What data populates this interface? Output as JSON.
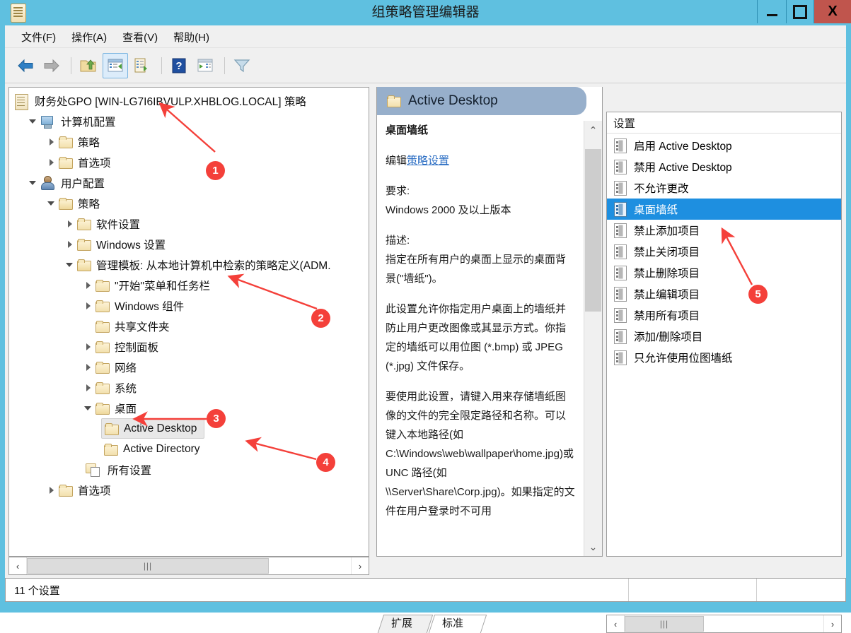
{
  "window": {
    "title": "组策略管理编辑器",
    "icon": "policy-scroll-icon",
    "controls": {
      "minimize": "–",
      "maximize": "□",
      "close": "X"
    },
    "titlebar_color": "#5FC0E0",
    "close_color": "#C0554D"
  },
  "menubar": {
    "items": [
      {
        "label": "文件(F)"
      },
      {
        "label": "操作(A)"
      },
      {
        "label": "查看(V)"
      },
      {
        "label": "帮助(H)"
      }
    ]
  },
  "toolbar": {
    "buttons": [
      {
        "name": "back-icon",
        "selected": false
      },
      {
        "name": "forward-icon",
        "selected": false
      },
      {
        "name": "up-folder-icon",
        "selected": false
      },
      {
        "name": "show-hide-tree-icon",
        "selected": true
      },
      {
        "name": "export-list-icon",
        "selected": false
      },
      {
        "name": "help-icon",
        "selected": false
      },
      {
        "name": "properties-icon",
        "selected": false
      },
      {
        "name": "filter-icon",
        "selected": false
      }
    ]
  },
  "tree": {
    "nodes": [
      {
        "label": "财务处GPO [WIN-LG7I6IBVULP.XHBLOG.LOCAL] 策略",
        "indent": 0,
        "icon": "policy-scroll-icon",
        "expander": "none",
        "selected": false
      },
      {
        "label": "计算机配置",
        "indent": 1,
        "icon": "computer-icon",
        "expander": "open",
        "selected": false
      },
      {
        "label": "策略",
        "indent": 2,
        "icon": "folder-icon",
        "expander": "closed",
        "selected": false
      },
      {
        "label": "首选项",
        "indent": 2,
        "icon": "folder-icon",
        "expander": "closed",
        "selected": false
      },
      {
        "label": "用户配置",
        "indent": 1,
        "icon": "user-icon",
        "expander": "open",
        "selected": false
      },
      {
        "label": "策略",
        "indent": 2,
        "icon": "folder-icon",
        "expander": "open",
        "selected": false
      },
      {
        "label": "软件设置",
        "indent": 3,
        "icon": "folder-icon",
        "expander": "closed",
        "selected": false
      },
      {
        "label": "Windows 设置",
        "indent": 3,
        "icon": "folder-icon",
        "expander": "closed",
        "selected": false
      },
      {
        "label": "管理模板: 从本地计算机中检索的策略定义(ADM.",
        "indent": 3,
        "icon": "folder-icon",
        "expander": "open",
        "selected": false
      },
      {
        "label": "\"开始\"菜单和任务栏",
        "indent": 4,
        "icon": "folder-icon",
        "expander": "closed",
        "selected": false
      },
      {
        "label": "Windows 组件",
        "indent": 4,
        "icon": "folder-icon",
        "expander": "closed",
        "selected": false
      },
      {
        "label": "共享文件夹",
        "indent": 4,
        "icon": "folder-icon",
        "expander": "none",
        "selected": false
      },
      {
        "label": "控制面板",
        "indent": 4,
        "icon": "folder-icon",
        "expander": "closed",
        "selected": false
      },
      {
        "label": "网络",
        "indent": 4,
        "icon": "folder-icon",
        "expander": "closed",
        "selected": false
      },
      {
        "label": "系统",
        "indent": 4,
        "icon": "folder-icon",
        "expander": "closed",
        "selected": false
      },
      {
        "label": "桌面",
        "indent": 4,
        "icon": "folder-icon",
        "expander": "open",
        "selected": false
      },
      {
        "label": "Active Desktop",
        "indent": 5,
        "icon": "folder-icon",
        "expander": "none",
        "selected": true
      },
      {
        "label": "Active Directory",
        "indent": 5,
        "icon": "folder-icon",
        "expander": "none",
        "selected": false
      },
      {
        "label": "所有设置",
        "indent": 4,
        "icon": "all-settings-icon",
        "expander": "none",
        "selected": false
      },
      {
        "label": "首选项",
        "indent": 2,
        "icon": "folder-icon",
        "expander": "closed",
        "selected": false
      }
    ]
  },
  "detail": {
    "header_title": "Active Desktop",
    "header_icon": "folder-icon",
    "setting_name": "桌面墙纸",
    "edit_prefix": "编辑",
    "edit_link": "策略设置",
    "requirements_label": "要求:",
    "requirements_value": "Windows 2000 及以上版本",
    "description_label": "描述:",
    "description_p1": "指定在所有用户的桌面上显示的桌面背景(\"墙纸\")。",
    "description_p2": "此设置允许你指定用户桌面上的墙纸并防止用户更改图像或其显示方式。你指定的墙纸可以用位图 (*.bmp) 或 JPEG (*.jpg) 文件保存。",
    "description_p3": "要使用此设置，请键入用来存储墙纸图像的文件的完全限定路径和名称。可以键入本地路径(如 C:\\Windows\\web\\wallpaper\\home.jpg)或 UNC 路径(如 \\\\Server\\Share\\Corp.jpg)。如果指定的文件在用户登录时不可用"
  },
  "list": {
    "column_header": "设置",
    "items": [
      {
        "label": "启用 Active Desktop",
        "selected": false
      },
      {
        "label": "禁用 Active Desktop",
        "selected": false
      },
      {
        "label": "不允许更改",
        "selected": false
      },
      {
        "label": "桌面墙纸",
        "selected": true
      },
      {
        "label": "禁止添加项目",
        "selected": false
      },
      {
        "label": "禁止关闭项目",
        "selected": false
      },
      {
        "label": "禁止删除项目",
        "selected": false
      },
      {
        "label": "禁止编辑项目",
        "selected": false
      },
      {
        "label": "禁用所有项目",
        "selected": false
      },
      {
        "label": "添加/删除项目",
        "selected": false
      },
      {
        "label": "只允许使用位图墙纸",
        "selected": false
      }
    ]
  },
  "tabs": {
    "items": [
      {
        "label": "扩展",
        "active": false
      },
      {
        "label": "标准",
        "active": true
      }
    ]
  },
  "statusbar": {
    "text": "11 个设置"
  },
  "scrollbars": {
    "tree_left_arrow": "‹",
    "tree_right_arrow": "›",
    "thumb_grip": "|||",
    "up_arrow": "⌃",
    "down_arrow": "⌄"
  },
  "annotations": {
    "color": "#F4403A",
    "markers": [
      {
        "label": "1"
      },
      {
        "label": "2"
      },
      {
        "label": "3"
      },
      {
        "label": "4"
      },
      {
        "label": "5"
      }
    ]
  }
}
